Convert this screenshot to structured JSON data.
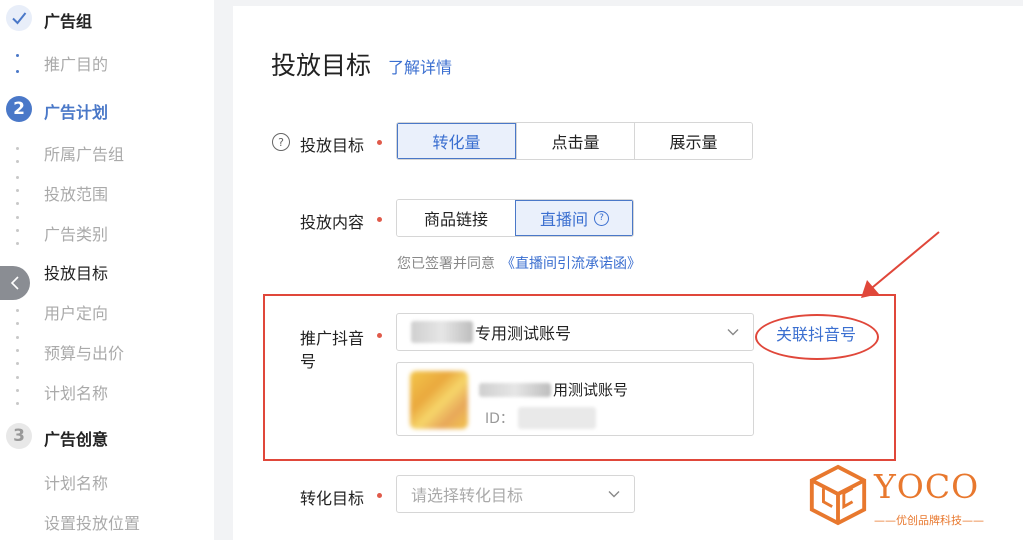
{
  "sidebar": {
    "groups": [
      {
        "step": "",
        "title": "广告组",
        "state": "done"
      },
      {
        "step": "2",
        "title": "广告计划",
        "state": "active"
      },
      {
        "step": "3",
        "title": "广告创意",
        "state": "pending"
      }
    ],
    "group1_items": [
      "推广目的"
    ],
    "group2_items": [
      "所属广告组",
      "投放范围",
      "广告类别",
      "投放目标",
      "用户定向",
      "预算与出价",
      "计划名称"
    ],
    "group3_items": [
      "计划名称",
      "设置投放位置"
    ],
    "current_item": "投放目标"
  },
  "main": {
    "title": "投放目标",
    "learn_more": "了解详情",
    "goal": {
      "label": "投放目标",
      "options": [
        "转化量",
        "点击量",
        "展示量"
      ],
      "selected": "转化量"
    },
    "content": {
      "label": "投放内容",
      "options": [
        "商品链接",
        "直播间"
      ],
      "selected": "直播间"
    },
    "agreement": {
      "text": "您已签署并同意",
      "link": "《直播间引流承诺函》"
    },
    "douyin": {
      "label_line1": "推广抖音",
      "label_line2": "号",
      "selected_value": "专用测试账号",
      "relate_link": "关联抖音号",
      "account_name": "用测试账号",
      "account_id_label": "ID："
    },
    "conversion": {
      "label": "转化目标",
      "placeholder": "请选择转化目标"
    }
  },
  "watermark": {
    "brand": "YOCO",
    "tagline": "——优创品牌科技——"
  },
  "colors": {
    "accent": "#4a78c8",
    "link": "#3b6fd0",
    "required": "#e05a4a",
    "highlight": "#e0473a",
    "watermark": "#e8782e"
  }
}
